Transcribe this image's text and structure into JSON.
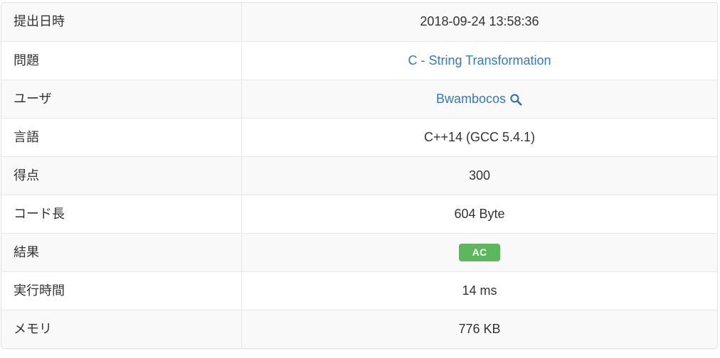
{
  "submission": {
    "rows": [
      {
        "label": "提出日時",
        "value": "2018-09-24 13:58:36",
        "type": "text"
      },
      {
        "label": "問題",
        "value": "C - String Transformation",
        "type": "link"
      },
      {
        "label": "ユーザ",
        "value": "Bwambocos",
        "type": "user"
      },
      {
        "label": "言語",
        "value": "C++14 (GCC 5.4.1)",
        "type": "text"
      },
      {
        "label": "得点",
        "value": "300",
        "type": "text"
      },
      {
        "label": "コード長",
        "value": "604 Byte",
        "type": "text"
      },
      {
        "label": "結果",
        "value": "AC",
        "type": "badge"
      },
      {
        "label": "実行時間",
        "value": "14 ms",
        "type": "text"
      },
      {
        "label": "メモリ",
        "value": "776 KB",
        "type": "text"
      }
    ],
    "icons": {
      "user_search": "search-icon"
    },
    "colors": {
      "link": "#337ab7",
      "badge_ac_background": "#5cb85c",
      "badge_ac_text": "#ffffff",
      "stripe": "#f9f9f9",
      "border": "#e8e8e8",
      "text": "#333333"
    }
  }
}
